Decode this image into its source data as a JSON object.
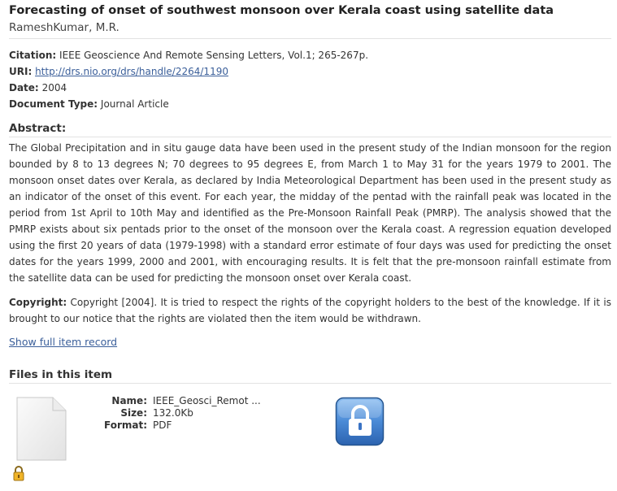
{
  "item": {
    "title": "Forecasting of onset of southwest monsoon over Kerala coast using satellite data",
    "author": "RameshKumar, M.R."
  },
  "metadata": {
    "citation_label": "Citation:",
    "citation_value": "IEEE Geoscience And Remote Sensing Letters, Vol.1; 265-267p.",
    "uri_label": "URI:",
    "uri_value": "http://drs.nio.org/drs/handle/2264/1190",
    "date_label": "Date:",
    "date_value": "2004",
    "doctype_label": "Document Type:",
    "doctype_value": "Journal Article"
  },
  "abstract": {
    "heading": "Abstract:",
    "text": "The Global Precipitation and in situ gauge data have been used in the present study of the Indian monsoon for the region bounded by 8 to 13 degrees N; 70 degrees to 95 degrees E, from March 1 to May 31 for the years 1979 to 2001. The monsoon onset dates over Kerala, as declared by India Meteorological Department has been used in the present study as an indicator of the onset of this event. For each year, the midday of the pentad with the rainfall peak was located in the period from 1st April to 10th May and identified as the Pre-Monsoon Rainfall Peak (PMRP). The analysis showed that the PMRP exists about six pentads prior to the onset of the monsoon over the Kerala coast. A regression equation developed using the first 20 years of data (1979-1998) with a standard error estimate of four days was used for predicting the onset dates for the years 1999, 2000 and 2001, with encouraging results. It is felt that the pre-monsoon rainfall estimate from the satellite data can be used for predicting the monsoon onset over Kerala coast."
  },
  "copyright": {
    "label": "Copyright:",
    "text": "Copyright [2004]. It is tried to respect the rights of the copyright holders to the best of the knowledge. If it is brought to our notice that the rights are violated then the item would be withdrawn."
  },
  "links": {
    "show_full": "Show full item record"
  },
  "files": {
    "heading": "Files in this item",
    "name_label": "Name:",
    "name_value": "IEEE_Geosci_Remot ...",
    "size_label": "Size:",
    "size_value": "132.0Kb",
    "format_label": "Format:",
    "format_value": "PDF"
  },
  "icons": {
    "file_thumbnail": "document-icon",
    "access_small": "padlock-icon",
    "access_large": "lock-icon"
  },
  "colors": {
    "link": "#3b5f9a",
    "lock_blue": "#3f83cf"
  }
}
